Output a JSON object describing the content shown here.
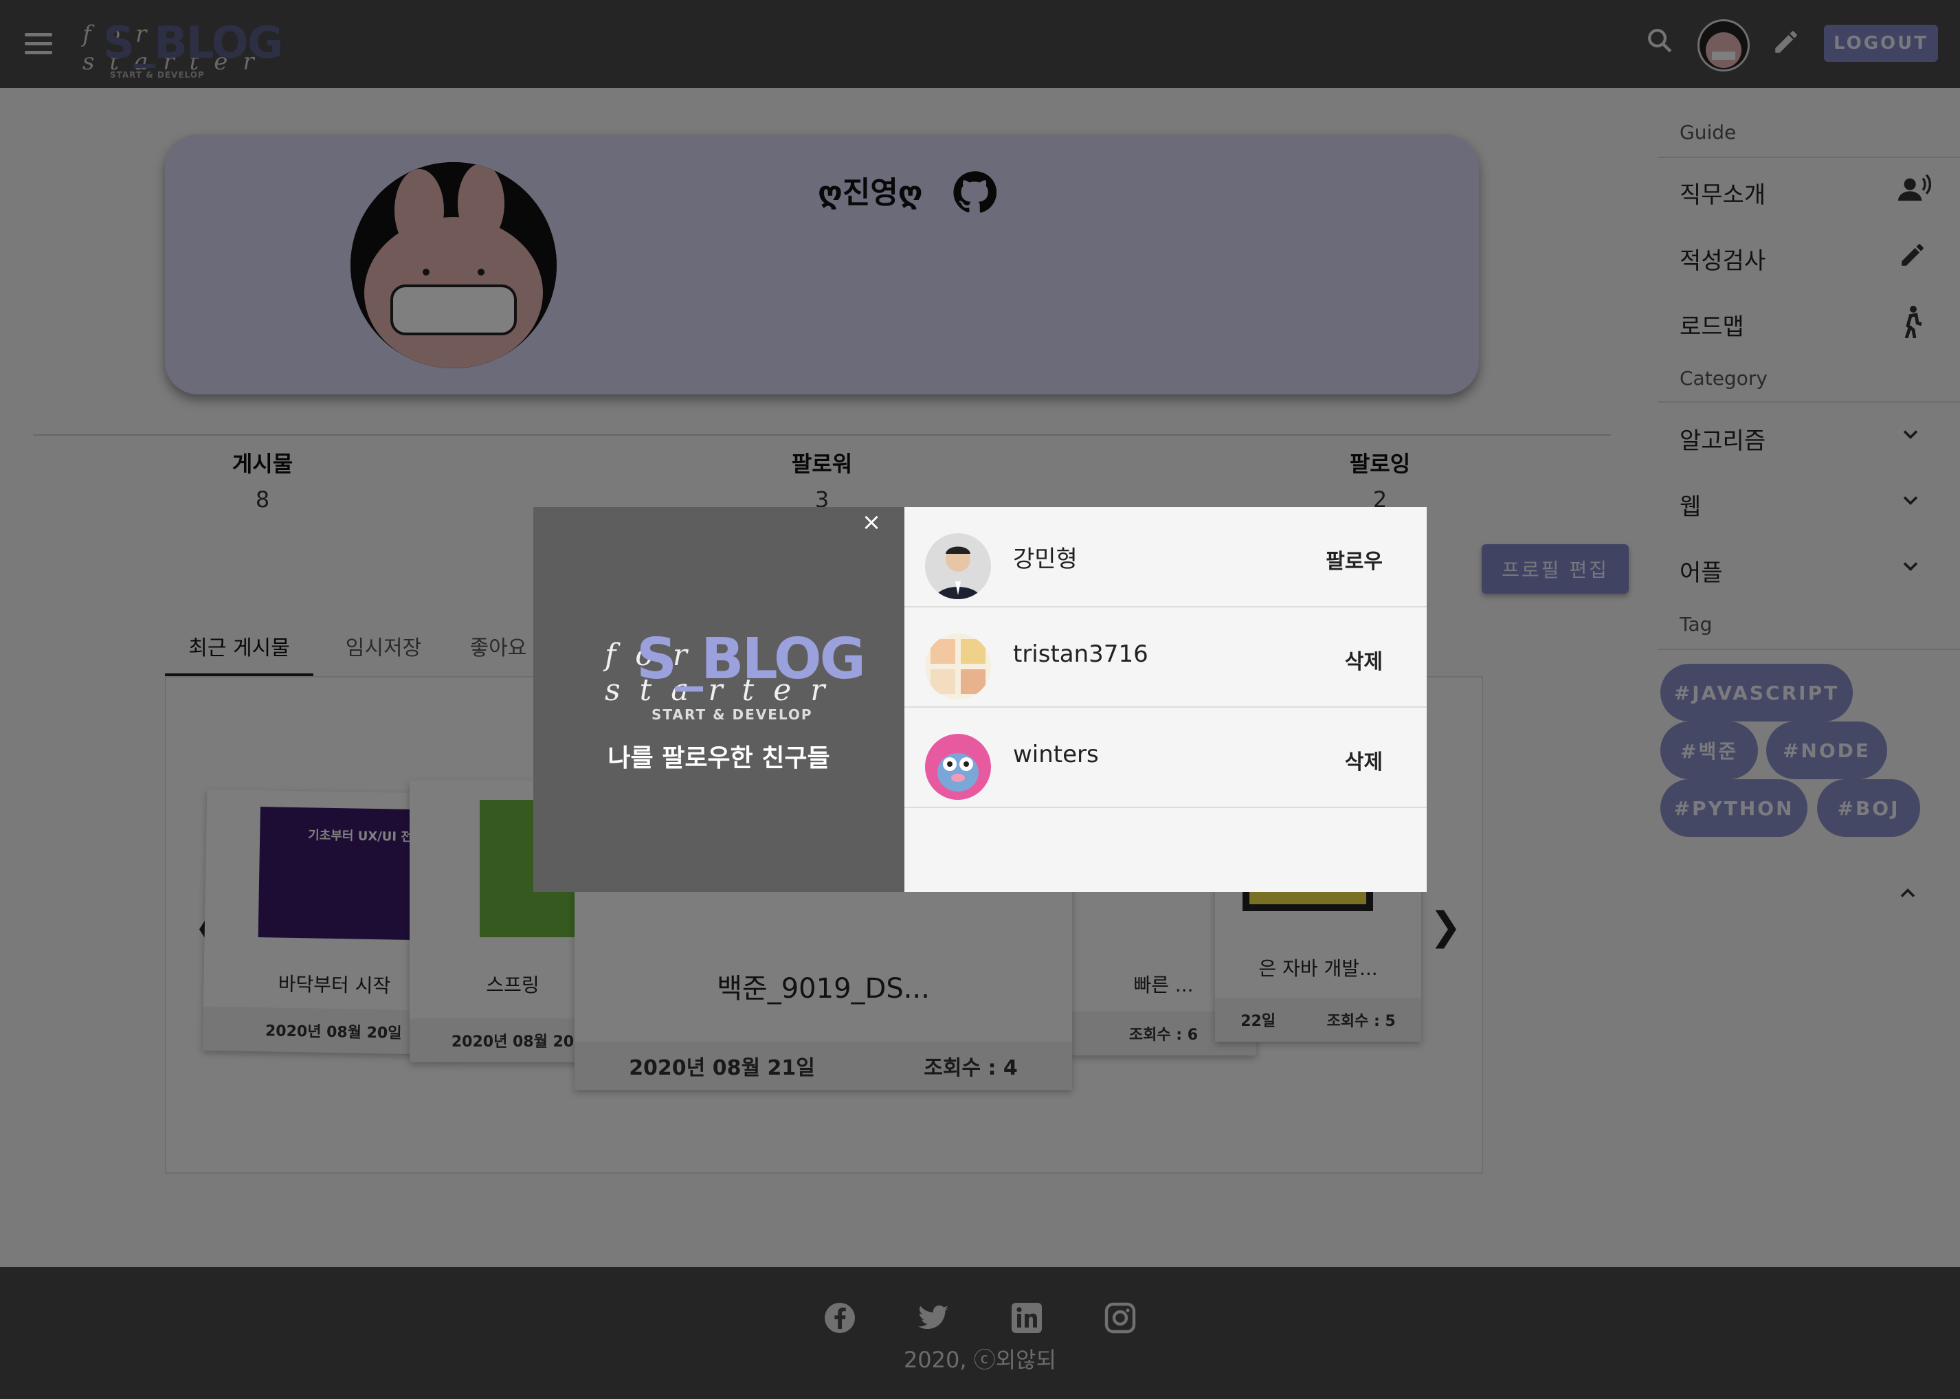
{
  "header": {
    "logo_script": "for starter",
    "logo_main": "S_BLOG",
    "logo_sub": "START & DEVELOP",
    "logout_label": "LOGOUT",
    "icons": [
      "menu-icon",
      "search-icon",
      "avatar",
      "pencil-icon"
    ]
  },
  "profile": {
    "name": "ღ진영ღ",
    "github_icon": "github-icon"
  },
  "stats": [
    {
      "label": "게시물",
      "value": "8"
    },
    {
      "label": "팔로워",
      "value": "3"
    },
    {
      "label": "팔로잉",
      "value": "2"
    }
  ],
  "edit_profile_label": "프로필 편집",
  "tabs": [
    "최근 게시물",
    "임시저장",
    "좋아요"
  ],
  "posts": [
    {
      "title": "바닥부터 시작",
      "date": "2020년 08월 20일",
      "views": ""
    },
    {
      "title": "스프링",
      "date": "2020년 08월 20",
      "views": ""
    },
    {
      "title": "백준_9019_DS...",
      "date": "2020년 08월 21일",
      "views": "조회수 : 4"
    },
    {
      "title": "빠른 ...",
      "date": "",
      "views": "조회수 : 6"
    },
    {
      "title": "은 자바 개발...",
      "date": "22일",
      "views": "조회수 : 5"
    }
  ],
  "post_thumbs_text": [
    "기초부터 UX/UI 전문"
  ],
  "carousel": {
    "prev": "❮",
    "next": "❯"
  },
  "sidebar": {
    "guide_heading": "Guide",
    "guide_items": [
      {
        "label": "직무소개",
        "icon": "person-voice-icon"
      },
      {
        "label": "적성검사",
        "icon": "pencil-icon"
      },
      {
        "label": "로드맵",
        "icon": "walking-person-icon"
      }
    ],
    "category_heading": "Category",
    "category_items": [
      {
        "label": "알고리즘",
        "icon": "chevron-down-icon"
      },
      {
        "label": "웹",
        "icon": "chevron-down-icon"
      },
      {
        "label": "어플",
        "icon": "chevron-down-icon"
      }
    ],
    "tag_heading": "Tag",
    "tags": [
      "#JAVASCRIPT",
      "#백준",
      "#NODE",
      "#PYTHON",
      "#BOJ"
    ]
  },
  "footer": {
    "icons": [
      "facebook-icon",
      "twitter-icon",
      "linkedin-icon",
      "instagram-icon"
    ],
    "copyright": "2020, ⓒ외않되"
  },
  "modal": {
    "close": "×",
    "logo_script": "for starter",
    "logo_main": "S_BLOG",
    "logo_sub": "START & DEVELOP",
    "title": "나를 팔로우한 친구들",
    "followers": [
      {
        "name": "강민형",
        "action": "팔로우"
      },
      {
        "name": "tristan3716",
        "action": "삭제"
      },
      {
        "name": "winters",
        "action": "삭제"
      }
    ]
  }
}
